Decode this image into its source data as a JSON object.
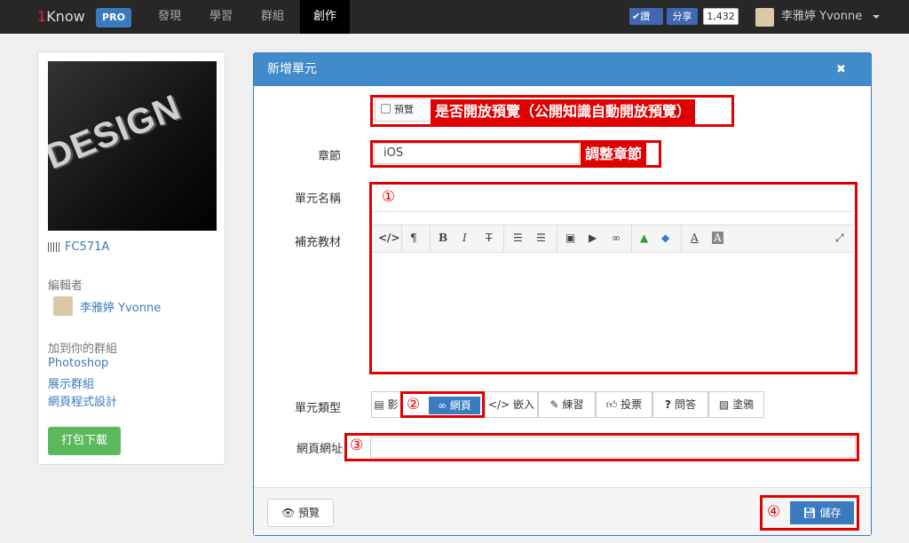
{
  "topnav": {
    "brand_one": "1",
    "brand_know": "Know",
    "pro_badge": "PRO",
    "items": [
      {
        "label": "發現"
      },
      {
        "label": "學習"
      },
      {
        "label": "群組"
      },
      {
        "label": "創作"
      }
    ],
    "like_label": "讚",
    "share_label": "分享",
    "share_count": "1,432",
    "user_name": "李雅婷 Yvonne"
  },
  "sidebar": {
    "cover_text": "DESIGN",
    "course_code": "FC571A",
    "editor_heading": "編輯者",
    "editor_name": "李雅婷 Yvonne",
    "groups_heading": "加到你的群組",
    "groups": [
      "Photoshop",
      "展示群組",
      "網頁程式設計"
    ],
    "download_button": "打包下載"
  },
  "modal": {
    "title": "新增單元",
    "close_icon": "✖",
    "preview_checkbox_label": "預覽",
    "preview_annotation": "是否開放預覽（公開知識自動開放預覽）",
    "chapter_label": "章節",
    "chapter_value": "iOS",
    "chapter_annotation": "調整章節",
    "unit_name_label": "單元名稱",
    "unit_name_marker": "①",
    "supplement_label": "補充教材",
    "unit_type_label": "單元類型",
    "unit_type_marker": "②",
    "unit_types": [
      {
        "label": "影"
      },
      {
        "label": "網頁"
      },
      {
        "label": "嵌入"
      },
      {
        "label": "練習"
      },
      {
        "label": "投票"
      },
      {
        "label": "問答"
      },
      {
        "label": "塗鴉"
      }
    ],
    "url_label": "網頁網址",
    "url_marker": "③",
    "save_marker": "④",
    "preview_button": "預覽",
    "save_button": "儲存"
  },
  "colors": {
    "accent": "#428bca",
    "annotation_red": "#e00000",
    "download_green": "#5cb85c"
  }
}
